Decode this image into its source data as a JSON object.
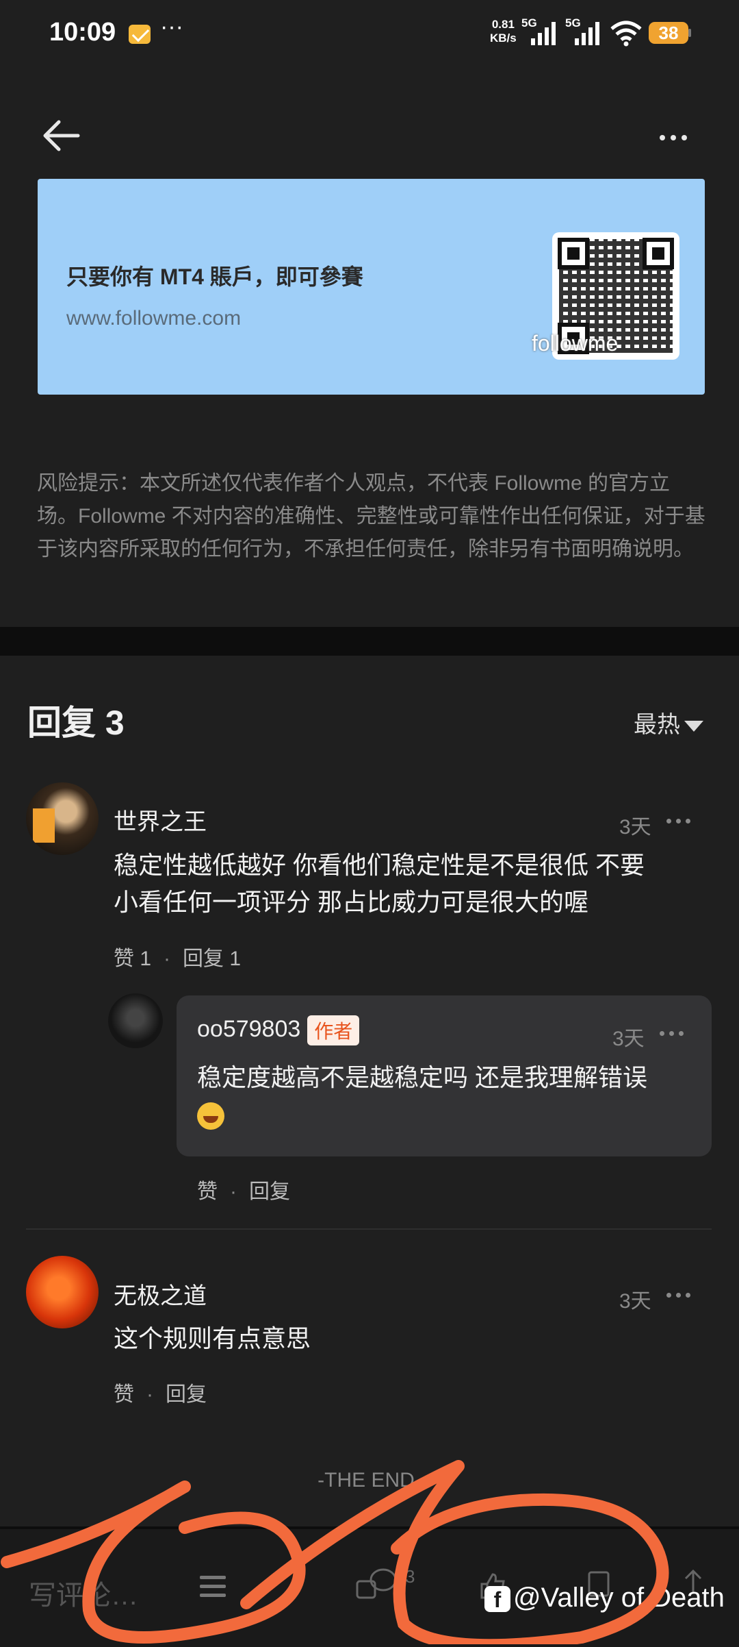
{
  "status_bar": {
    "time": "10:09",
    "dots": "···",
    "net_speed_value": "0.81",
    "net_speed_unit": "KB/s",
    "signal1_label": "5G",
    "signal2_label": "5G",
    "battery": "38"
  },
  "banner": {
    "text": "只要你有 MT4 賬戶，即可參賽",
    "url": "www.followme.com",
    "watermark": "followme"
  },
  "risk_notice": "风险提示：本文所述仅代表作者个人观点，不代表 Followme 的官方立场。Followme 不对内容的准确性、完整性或可靠性作出任何保证，对于基于该内容所采取的任何行为，不承担任何责任，除非另有书面明确说明。",
  "replies": {
    "header": "回复 3",
    "sort_label": "最热",
    "comments": [
      {
        "user": "世界之王",
        "time": "3天",
        "text_line1": "稳定性越低越好 你看他们稳定性是不是很低 不要",
        "text_line2": "小看任何一项评分 那占比威力可是很大的喔",
        "like_label": "赞 1",
        "reply_label": "回复 1"
      },
      {
        "user": "oo579803",
        "badge": "作者",
        "time": "3天",
        "text": "稳定度越高不是越稳定吗 还是我理解错误",
        "like_label": "赞",
        "reply_label": "回复"
      },
      {
        "user": "无极之道",
        "time": "3天",
        "text": "这个规则有点意思",
        "like_label": "赞",
        "reply_label": "回复"
      }
    ]
  },
  "end_marker": "-THE END-",
  "bottom_bar": {
    "input_placeholder": "写评论…",
    "comment_count": "3",
    "watermark": "@Valley of Death"
  },
  "colors": {
    "background": "#1f1f1f",
    "banner": "#9fcff8",
    "author_badge": "#e8541e",
    "scribble": "#f26a3c"
  },
  "icons": [
    "back-arrow-icon",
    "more-icon",
    "menu-icon",
    "comment-icon",
    "like-icon",
    "bookmark-icon",
    "share-icon",
    "facebook-icon"
  ]
}
